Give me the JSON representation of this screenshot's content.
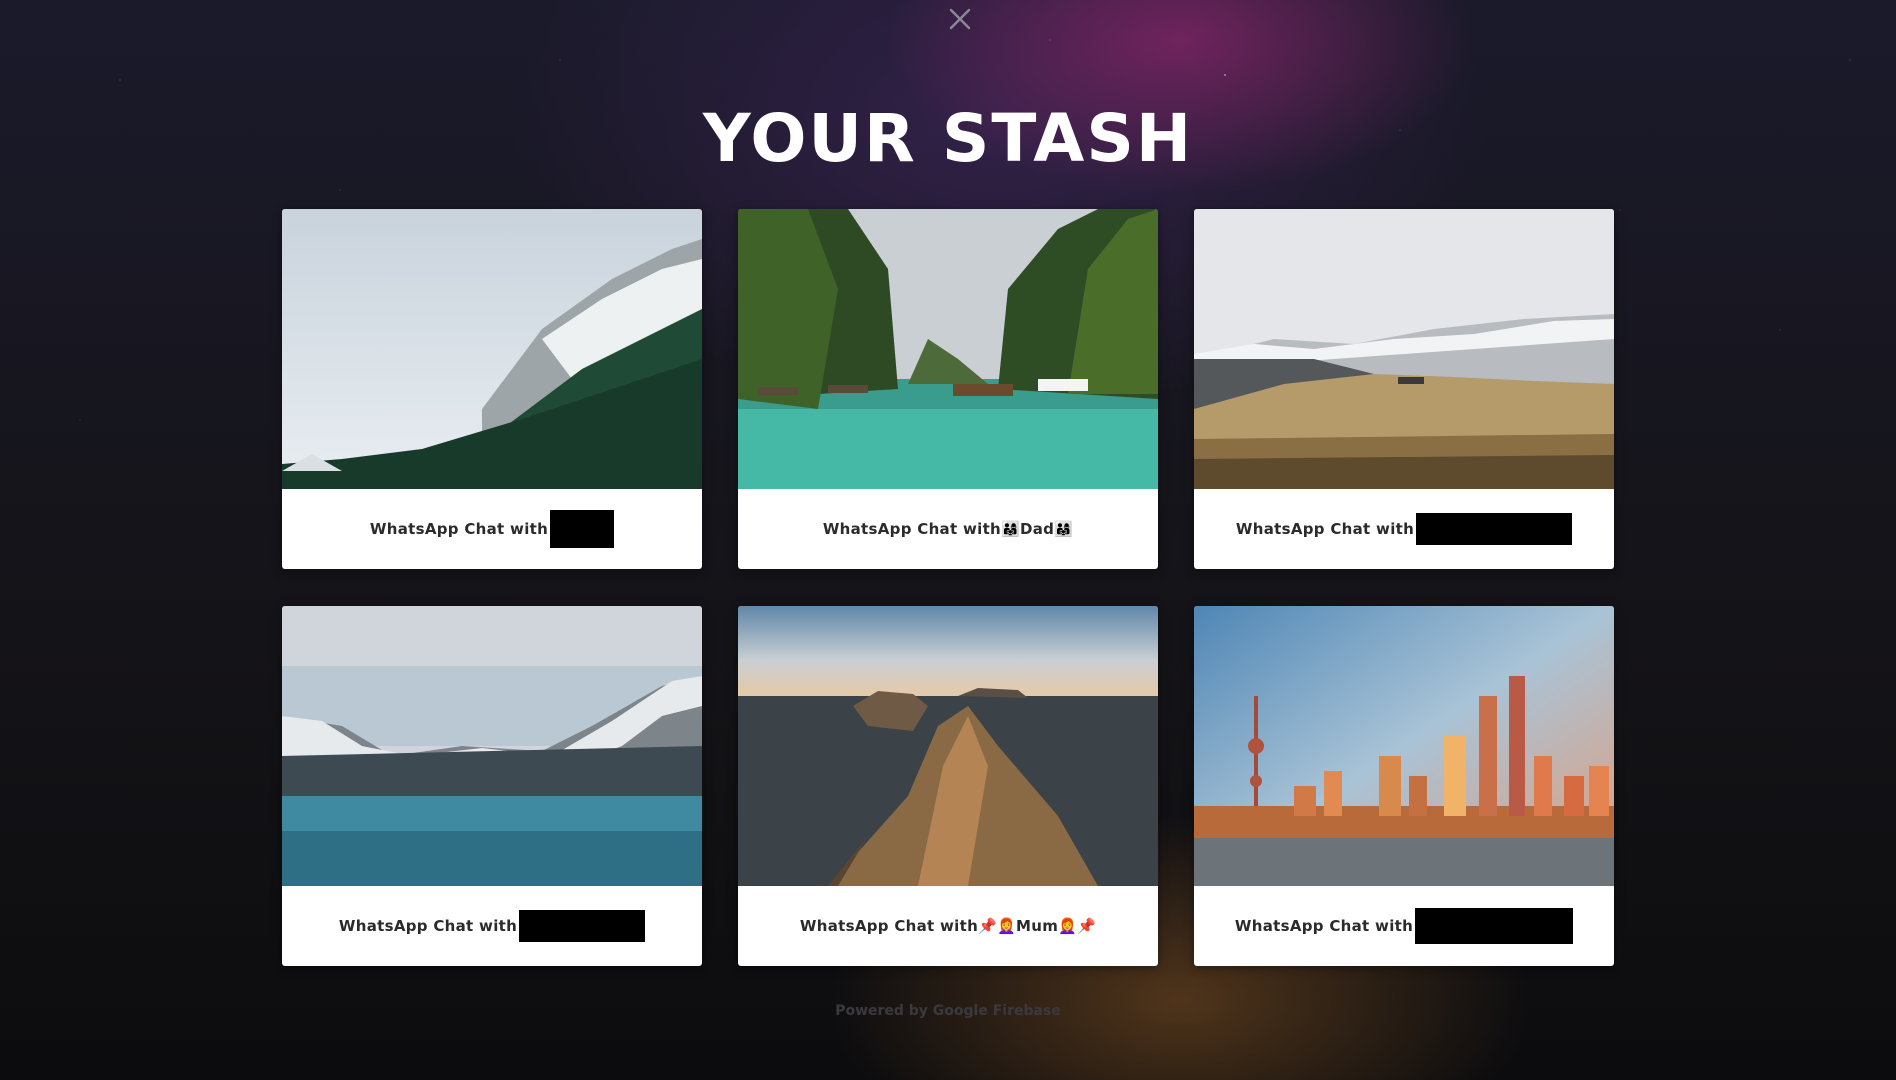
{
  "page": {
    "title": "YOUR STASH",
    "footer": "Powered by Google Firebase"
  },
  "close_icon": "close-icon",
  "cards": [
    {
      "caption": "WhatsApp Chat with",
      "suffix": "",
      "image": "canadian-rockies-mountain-photo"
    },
    {
      "caption": "WhatsApp Chat with",
      "suffix": " 👨‍👩‍👧Dad👨‍👩‍👧",
      "image": "lagoon-longtail-boats-photo"
    },
    {
      "caption": "WhatsApp Chat with",
      "suffix": "",
      "image": "iceland-hills-photo"
    },
    {
      "caption": "WhatsApp Chat with",
      "suffix": "",
      "image": "mountain-lake-photo"
    },
    {
      "caption": "WhatsApp Chat with",
      "suffix": " 📌👩‍🦰Mum👩‍🦰📌",
      "image": "sea-cliffs-islands-photo"
    },
    {
      "caption": "WhatsApp Chat with",
      "suffix": "",
      "image": "city-skyline-sunset-photo"
    }
  ],
  "colors": {
    "card_bg": "#ffffff",
    "caption_text": "#2b2b2b",
    "title_text": "#ffffff"
  }
}
